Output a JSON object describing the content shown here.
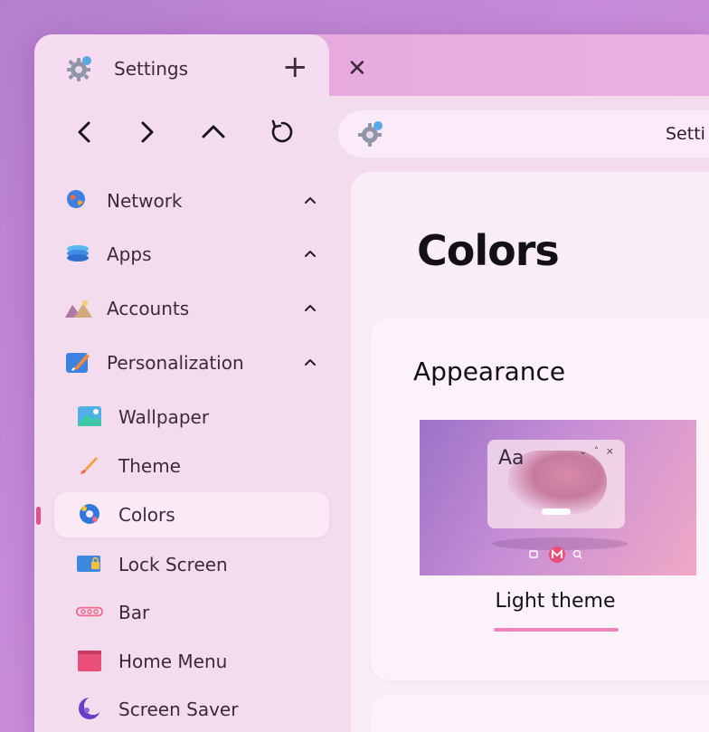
{
  "tab": {
    "title": "Settings",
    "icon": "settings-gear-icon",
    "new_tab_glyph": "+",
    "close_glyph": "✕"
  },
  "nav": {
    "back": "chevron-left-icon",
    "forward": "chevron-right-icon",
    "up": "chevron-up-icon",
    "refresh": "refresh-icon"
  },
  "address": {
    "icon": "settings-gear-icon",
    "text": "Setti"
  },
  "sidebar": {
    "items": [
      {
        "label": "Network",
        "icon": "globe-icon"
      },
      {
        "label": "Apps",
        "icon": "apps-layers-icon"
      },
      {
        "label": "Accounts",
        "icon": "accounts-icon"
      },
      {
        "label": "Personalization",
        "icon": "personalization-brush-icon"
      }
    ],
    "subitems": [
      {
        "label": "Wallpaper",
        "icon": "wallpaper-icon"
      },
      {
        "label": "Theme",
        "icon": "theme-brush-icon"
      },
      {
        "label": "Colors",
        "icon": "colors-palette-icon",
        "selected": true
      },
      {
        "label": "Lock Screen",
        "icon": "lock-screen-icon"
      },
      {
        "label": "Bar",
        "icon": "bar-icon"
      },
      {
        "label": "Home Menu",
        "icon": "home-menu-icon"
      },
      {
        "label": "Screen Saver",
        "icon": "screen-saver-icon"
      }
    ]
  },
  "main": {
    "title": "Colors",
    "appearance": {
      "title": "Appearance",
      "preview_text": "Aa",
      "preview_controls": "⌄ ˄ ×",
      "option_label": "Light theme"
    }
  },
  "colors": {
    "accent": "#e05288",
    "underline": "#e984bb",
    "background": "#c58ad8"
  }
}
